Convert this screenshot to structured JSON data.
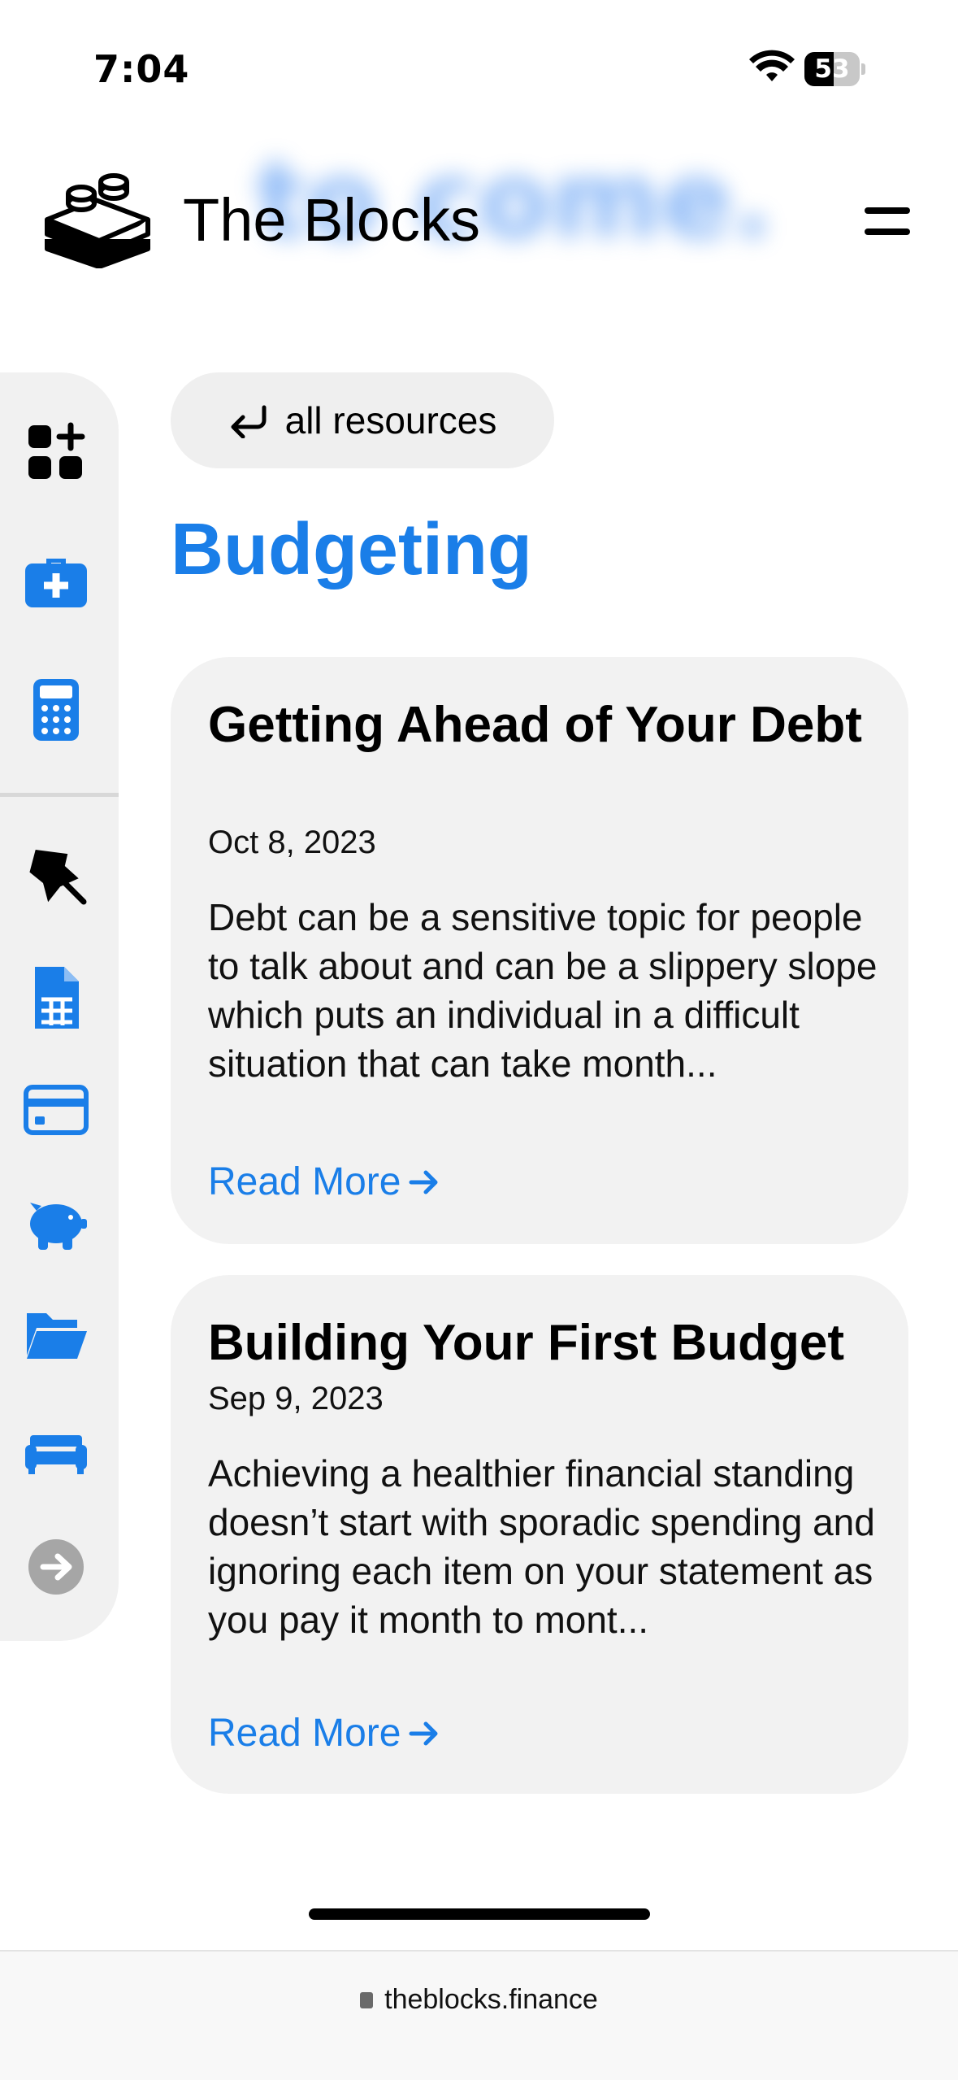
{
  "status_bar": {
    "time": "7:04",
    "battery_percent": "53",
    "battery_level": 0.53
  },
  "header": {
    "site_title": "The Blocks",
    "blurred_background_text": "to come."
  },
  "sidebar": {
    "items": [
      {
        "icon": "apps-add-icon"
      },
      {
        "icon": "medical-kit-icon"
      },
      {
        "icon": "calculator-icon"
      },
      {
        "icon": "pin-icon"
      },
      {
        "icon": "spreadsheet-file-icon"
      },
      {
        "icon": "credit-card-icon"
      },
      {
        "icon": "piggy-bank-icon"
      },
      {
        "icon": "open-folder-icon"
      },
      {
        "icon": "couch-icon"
      },
      {
        "icon": "arrow-right-circle-icon"
      }
    ]
  },
  "back_link": {
    "label": "all resources"
  },
  "page": {
    "title": "Budgeting"
  },
  "articles": [
    {
      "title": "Getting Ahead of Your Debt",
      "date": "Oct 8, 2023",
      "excerpt": "Debt can be a sensitive topic for people to talk about and can be a slippery slope which puts an individual in a difficult situation that can take month...",
      "read_more": "Read More"
    },
    {
      "title": "Building Your First Budget",
      "date": "Sep 9, 2023",
      "excerpt": "Achieving a healthier financial standing doesn’t start with sporadic spending and ignoring each item on your statement as you pay it month to mont...",
      "read_more": "Read More"
    }
  ],
  "url_bar": {
    "url": "theblocks.finance"
  },
  "colors": {
    "accent": "#1a7ee8",
    "card_bg": "#f2f2f2",
    "sidebar_bg": "#f1f1f1"
  }
}
